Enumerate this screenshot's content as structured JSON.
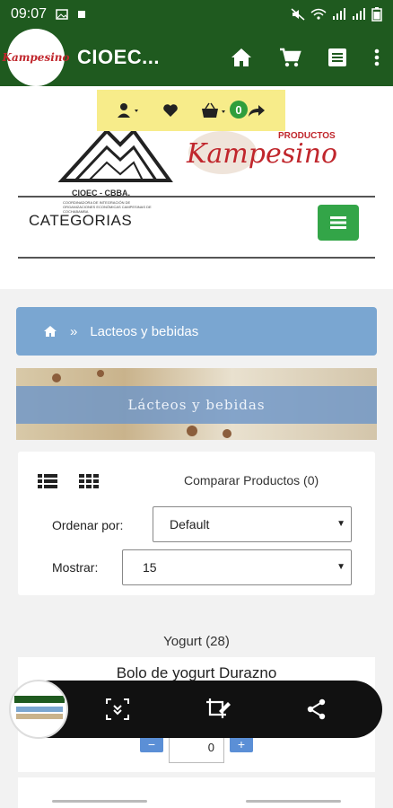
{
  "status_bar": {
    "time": "09:07"
  },
  "app_bar": {
    "logo_text": "Kampesino",
    "title": "CIOEC...",
    "icons": [
      "home-icon",
      "cart-icon",
      "list-icon",
      "more-vert-icon"
    ]
  },
  "toolbar": {
    "cart_count": "0",
    "icons": [
      "user-icon",
      "heart-icon",
      "basket-icon",
      "share-forward-icon"
    ]
  },
  "brand": {
    "cioec_label": "CIOEC - CBBA.",
    "cioec_subtitle": "COORDINADORA DE INTEGRACIÓN DE ORGANIZACIONES ECONÓMICAS CAMPESINAS DE COCHABAMBA",
    "kampesino_small": "PRODUCTOS",
    "kampesino_text": "Kampesino"
  },
  "categories": {
    "title": "CATEGORIAS"
  },
  "breadcrumb": {
    "separator": "»",
    "current": "Lacteos y bebidas"
  },
  "banner": {
    "text": "Lácteos y bebidas"
  },
  "filter": {
    "compare_label": "Comparar Productos (0)",
    "sort_label": "Ordenar por:",
    "sort_value": "Default",
    "show_label": "Mostrar:",
    "show_value": "15"
  },
  "product_group": {
    "label": "Yogurt (28)"
  },
  "product": {
    "name": "Bolo de yogurt Durazno",
    "quantity": "0",
    "minus": "−",
    "plus": "+"
  },
  "colors": {
    "app_green": "#1f5a1f",
    "accent_green": "#33a548",
    "breadcrumb_blue": "#7aa6d1",
    "toolbar_yellow": "#f7ec8a",
    "brand_red": "#c0262c"
  }
}
